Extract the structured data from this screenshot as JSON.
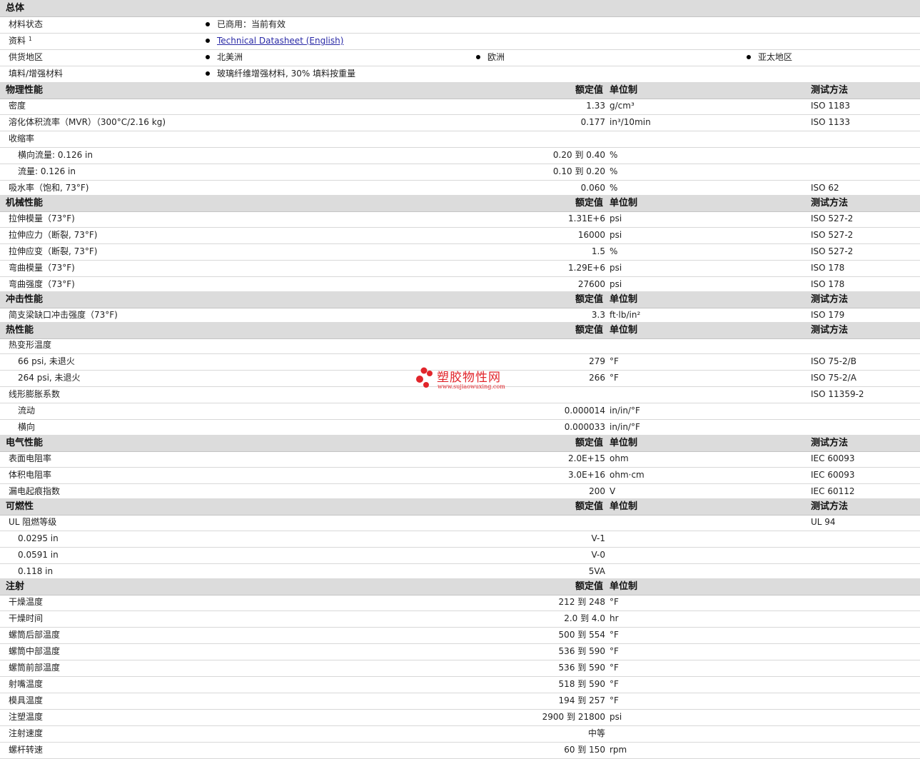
{
  "general": {
    "header": "总体",
    "rows": [
      {
        "label": "材料状态",
        "values": [
          "已商用：当前有效"
        ]
      },
      {
        "label": "资料",
        "sup": "1",
        "link": "Technical Datasheet (English)"
      },
      {
        "label": "供货地区",
        "values": [
          "北美洲",
          "欧洲",
          "亚太地区"
        ]
      },
      {
        "label": "填料/增强材料",
        "values": [
          "玻璃纤维增强材料, 30% 填料按重量"
        ]
      }
    ]
  },
  "column_labels": {
    "value": "额定值",
    "unit": "单位制",
    "method": "测试方法"
  },
  "sections": [
    {
      "title": "物理性能",
      "method_col": true,
      "rows": [
        {
          "label": "密度",
          "value": "1.33",
          "unit": "g/cm³",
          "method": "ISO 1183"
        },
        {
          "label": "溶化体积流率（MVR）（300°C/2.16 kg)",
          "value": "0.177",
          "unit": "in³/10min",
          "method": "ISO 1133"
        },
        {
          "label": "收缩率"
        },
        {
          "label": "横向流量: 0.126 in",
          "sub": true,
          "value": "0.20 到 0.40",
          "unit": "%"
        },
        {
          "label": "流量: 0.126 in",
          "sub": true,
          "value": "0.10 到 0.20",
          "unit": "%"
        },
        {
          "label": "吸水率（饱和, 73°F)",
          "value": "0.060",
          "unit": "%",
          "method": "ISO 62"
        }
      ]
    },
    {
      "title": "机械性能",
      "method_col": true,
      "rows": [
        {
          "label": "拉伸模量（73°F)",
          "value": "1.31E+6",
          "unit": "psi",
          "method": "ISO 527-2"
        },
        {
          "label": "拉伸应力（断裂, 73°F)",
          "value": "16000",
          "unit": "psi",
          "method": "ISO 527-2"
        },
        {
          "label": "拉伸应变（断裂, 73°F)",
          "value": "1.5",
          "unit": "%",
          "method": "ISO 527-2"
        },
        {
          "label": "弯曲模量（73°F)",
          "value": "1.29E+6",
          "unit": "psi",
          "method": "ISO 178"
        },
        {
          "label": "弯曲强度（73°F)",
          "value": "27600",
          "unit": "psi",
          "method": "ISO 178"
        }
      ]
    },
    {
      "title": "冲击性能",
      "method_col": true,
      "rows": [
        {
          "label": "简支梁缺口冲击强度（73°F)",
          "value": "3.3",
          "unit": "ft·lb/in²",
          "method": "ISO 179"
        }
      ]
    },
    {
      "title": "热性能",
      "method_col": true,
      "rows": [
        {
          "label": "热变形温度"
        },
        {
          "label": "66 psi, 未退火",
          "sub": true,
          "value": "279",
          "unit": "°F",
          "method": "ISO 75-2/B"
        },
        {
          "label": "264 psi, 未退火",
          "sub": true,
          "value": "266",
          "unit": "°F",
          "method": "ISO 75-2/A"
        },
        {
          "label": "线形膨胀系数",
          "method": "ISO 11359-2"
        },
        {
          "label": "流动",
          "sub": true,
          "value": "0.000014",
          "unit": "in/in/°F"
        },
        {
          "label": "横向",
          "sub": true,
          "value": "0.000033",
          "unit": "in/in/°F"
        }
      ]
    },
    {
      "title": "电气性能",
      "method_col": true,
      "rows": [
        {
          "label": "表面电阻率",
          "value": "2.0E+15",
          "unit": "ohm",
          "method": "IEC 60093"
        },
        {
          "label": "体积电阻率",
          "value": "3.0E+16",
          "unit": "ohm·cm",
          "method": "IEC 60093"
        },
        {
          "label": "漏电起痕指数",
          "value": "200",
          "unit": "V",
          "method": "IEC 60112"
        }
      ]
    },
    {
      "title": "可燃性",
      "method_col": true,
      "rows": [
        {
          "label": "UL 阻燃等级",
          "method": "UL 94"
        },
        {
          "label": "0.0295 in",
          "sub": true,
          "value": "V-1"
        },
        {
          "label": "0.0591 in",
          "sub": true,
          "value": "V-0"
        },
        {
          "label": "0.118 in",
          "sub": true,
          "value": "5VA"
        }
      ]
    },
    {
      "title": "注射",
      "method_col": false,
      "rows": [
        {
          "label": "干燥温度",
          "value": "212 到 248",
          "unit": "°F"
        },
        {
          "label": "干燥时间",
          "value": "2.0 到 4.0",
          "unit": "hr"
        },
        {
          "label": "螺筒后部温度",
          "value": "500 到 554",
          "unit": "°F"
        },
        {
          "label": "螺筒中部温度",
          "value": "536 到 590",
          "unit": "°F"
        },
        {
          "label": "螺筒前部温度",
          "value": "536 到 590",
          "unit": "°F"
        },
        {
          "label": "射嘴温度",
          "value": "518 到 590",
          "unit": "°F"
        },
        {
          "label": "模具温度",
          "value": "194 到 257",
          "unit": "°F"
        },
        {
          "label": "注塑温度",
          "value": "2900 到 21800",
          "unit": "psi"
        },
        {
          "label": "注射速度",
          "value": "中等"
        },
        {
          "label": "螺杆转速",
          "value": "60 到 150",
          "unit": "rpm"
        }
      ]
    }
  ],
  "watermark": {
    "title": "塑胶物性网",
    "url": "www.sujiaowuxing.com",
    "color": "#e1252b"
  }
}
